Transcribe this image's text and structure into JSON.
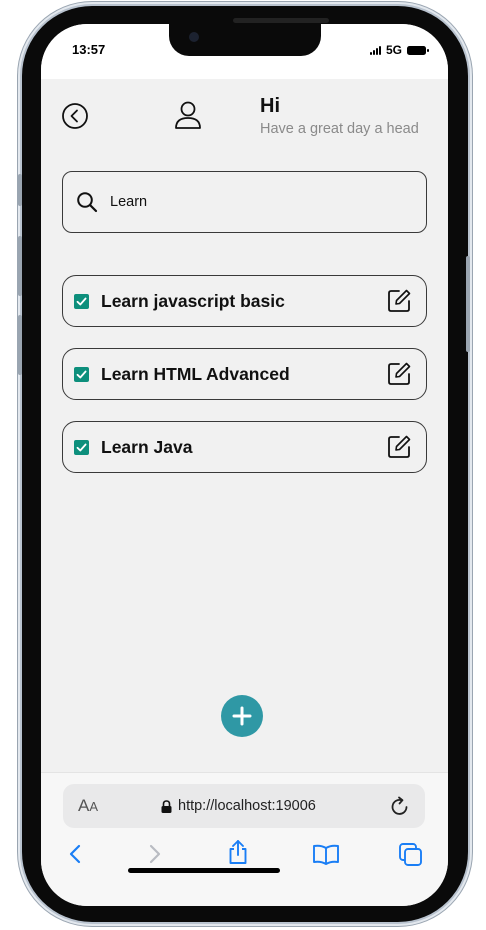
{
  "status": {
    "time": "13:57",
    "network": "5G"
  },
  "header": {
    "title": "Hi",
    "subtitle": "Have a great day a head"
  },
  "search": {
    "value": "Learn",
    "placeholder": ""
  },
  "tasks": [
    {
      "label": "Learn javascript basic",
      "checked": true
    },
    {
      "label": "Learn HTML Advanced",
      "checked": true
    },
    {
      "label": "Learn Java",
      "checked": true
    }
  ],
  "browser": {
    "aa_label": "A",
    "aa_small": "A",
    "url": "http://localhost:19006"
  },
  "colors": {
    "checkbox": "#0d8f7c",
    "fab": "#2f98a5",
    "ios_blue": "#1a7ef5",
    "background": "#f1f1f1"
  }
}
